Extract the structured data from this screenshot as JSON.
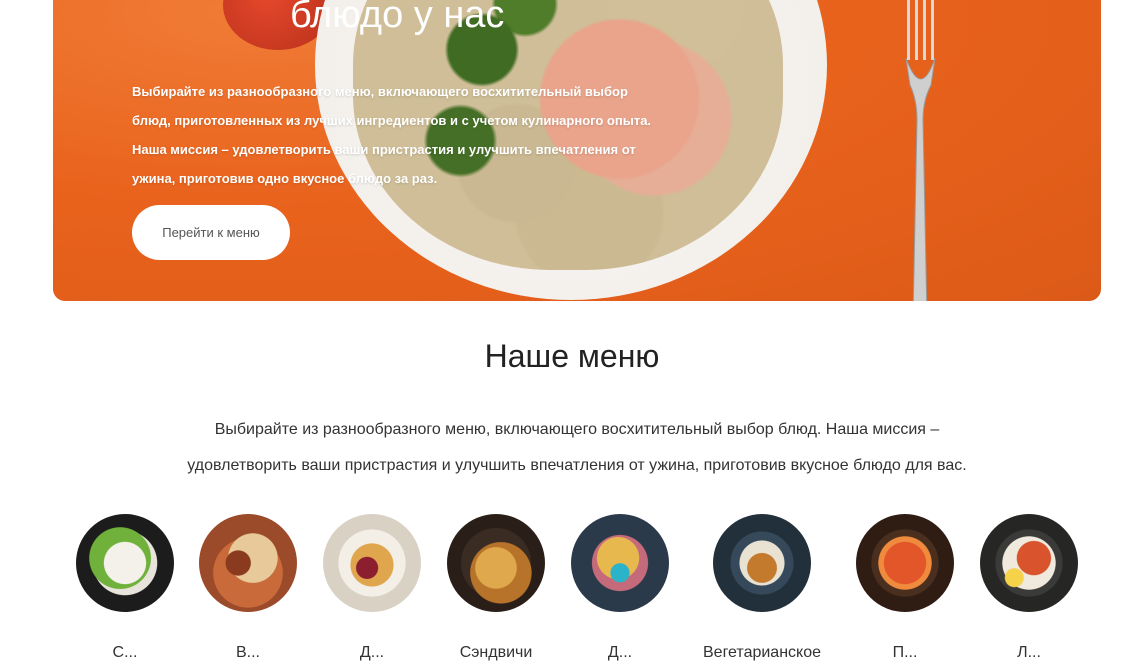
{
  "hero": {
    "title": "блюдо у нас",
    "text": "Выбирайте из разнообразного меню, включающего восхитительный выбор блюд, приготовленных из лучших ингредиентов и с учетом кулинарного опыта. Наша миссия – удовлетворить ваши пристрастия и улучшить впечатления от ужина, приготовив одно вкусное блюдо за раз.",
    "button_label": "Перейти к меню"
  },
  "menu": {
    "title": "Наше меню",
    "description": "Выбирайте из разнообразного меню, включающего восхитительный выбор блюд. Наша миссия – удовлетворить ваши пристрастия и улучшить впечатления от ужина, приготовив вкусное блюдо для вас.",
    "categories": [
      {
        "label": "С..."
      },
      {
        "label": "В..."
      },
      {
        "label": "Д..."
      },
      {
        "label": "Сэндвичи"
      },
      {
        "label": "Д..."
      },
      {
        "label": "Вегетарианское"
      },
      {
        "label": "П..."
      },
      {
        "label": "Л..."
      }
    ]
  }
}
